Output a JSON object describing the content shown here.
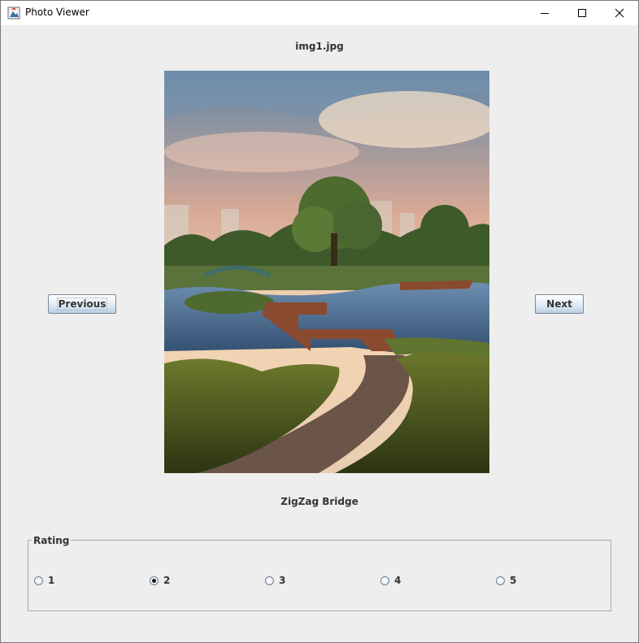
{
  "window": {
    "title": "Photo Viewer",
    "icon": "java-app-icon",
    "controls": [
      "minimize-icon",
      "maximize-icon",
      "close-icon"
    ]
  },
  "viewer": {
    "filename": "img1.jpg",
    "caption": "ZigZag Bridge",
    "previous_label": "Previous",
    "next_label": "Next",
    "photo_description_icon": "landscape-photo"
  },
  "rating": {
    "legend": "Rating",
    "options": [
      "1",
      "2",
      "3",
      "4",
      "5"
    ],
    "selected": "2"
  },
  "colors": {
    "window_bg": "#eeeeee",
    "button_gradient_bottom": "#b8cfe5",
    "text": "#333333"
  }
}
